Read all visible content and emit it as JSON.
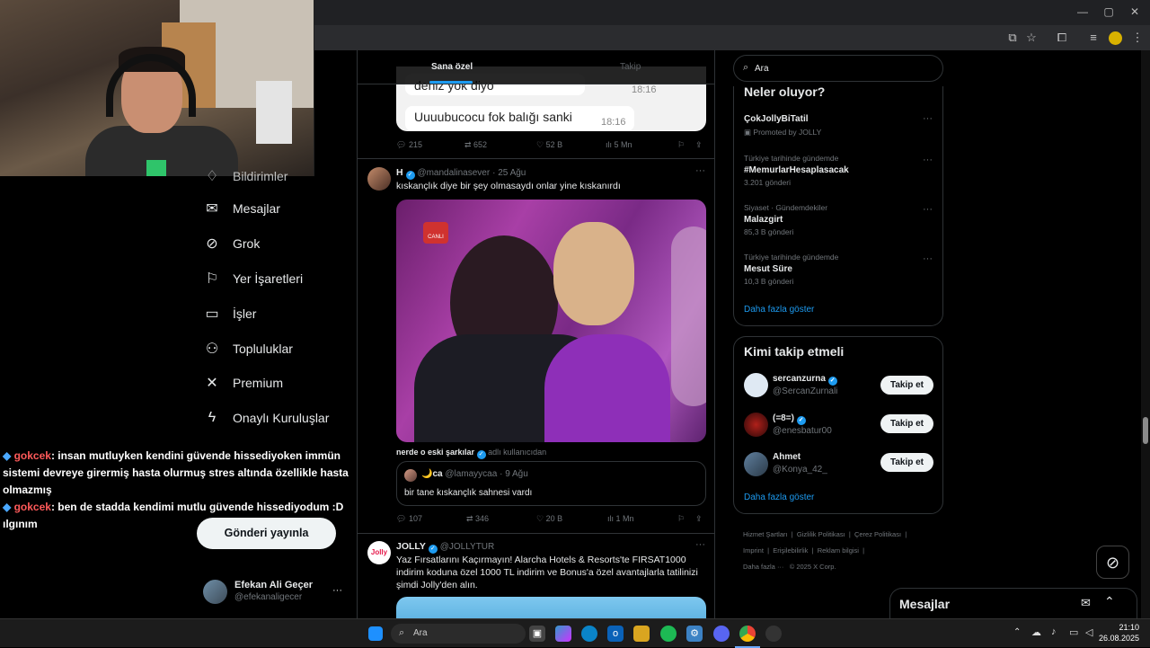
{
  "browser": {
    "minimize": "—",
    "maximize": "▢",
    "close": "✕"
  },
  "nav": {
    "partial_top": "Bildirimler",
    "items": [
      {
        "label": "Mesajlar",
        "icon": "envelope-icon"
      },
      {
        "label": "Grok",
        "icon": "grok-icon"
      },
      {
        "label": "Yer İşaretleri",
        "icon": "bookmark-icon"
      },
      {
        "label": "İşler",
        "icon": "briefcase-icon"
      },
      {
        "label": "Topluluklar",
        "icon": "people-icon"
      },
      {
        "label": "Premium",
        "icon": "x-logo-icon"
      },
      {
        "label": "Onaylı Kuruluşlar",
        "icon": "lightning-icon"
      }
    ],
    "post_button": "Gönderi yayınla",
    "profile": {
      "name": "Efekan Ali Geçer",
      "handle": "@efekanaligecer",
      "more": "···"
    }
  },
  "chat": [
    {
      "user": "gokcek",
      "text": ": insan mutluyken kendini güvende hissediyoken immün sistemi devreye girermiş hasta olurmuş stres altında özellikle hasta olmazmış"
    },
    {
      "user": "gokcek",
      "text": ": ben de stadda kendimi mutlu güvende hissediyodum :D ılgınım"
    }
  ],
  "feed": {
    "tabs": {
      "active": "Sana özel",
      "other": "Takip"
    },
    "prev_media": {
      "line1": "deniz yok diyo",
      "time1": "18:16",
      "line2": "Uuuubucocu fok balığı sanki",
      "time2": "18:16"
    },
    "prev_actions": {
      "replies": "215",
      "reposts": "652",
      "likes": "52 B",
      "views": "5 Mn"
    },
    "tweet1": {
      "name": "H",
      "handle": "@mandalinasever",
      "date": "· 25 Ağu",
      "text": "kıskançlık diye bir şey olmasaydı onlar yine kıskanırdı",
      "media_badge": "CANLI",
      "quote_header_name": "nerde o eski şarkılar",
      "quote_header_handle": "adlı kullanıcıdan",
      "quote": {
        "name": "🌙ca",
        "handle": "@lamayycaa",
        "date": "· 9 Ağu",
        "text": "bir tane kıskançlık sahnesi vardı"
      },
      "actions": {
        "replies": "107",
        "reposts": "346",
        "likes": "20 B",
        "views": "1 Mn"
      }
    },
    "tweet2": {
      "name": "JOLLY",
      "handle": "@JOLLYTUR",
      "avatar_text": "Jolly",
      "text": "Yaz Fırsatlarını Kaçırmayın! Alarcha Hotels & Resorts'te FIRSAT1000 indirim koduna özel 1000 TL indirim ve Bonus'a özel avantajlarla tatilinizi şimdi Jolly'den alın."
    }
  },
  "right": {
    "search_placeholder": "Ara",
    "trends_title": "Neler oluyor?",
    "trends": [
      {
        "context": "",
        "name": "ÇokJollyBiTatil",
        "meta": "Promoted by JOLLY"
      },
      {
        "context": "Türkiye tarihinde gündemde",
        "name": "#MemurlarHesaplasacak",
        "meta": "3.201 gönderi"
      },
      {
        "context": "Siyaset · Gündemdekiler",
        "name": "Malazgirt",
        "meta": "85,3 B gönderi"
      },
      {
        "context": "Türkiye tarihinde gündemde",
        "name": "Mesut Süre",
        "meta": "10,3 B gönderi"
      }
    ],
    "trends_more": "Daha fazla göster",
    "who_title": "Kimi takip etmeli",
    "who": [
      {
        "name": "sercanzurna",
        "handle": "@SercanZurnali",
        "button": "Takip et"
      },
      {
        "name": "(=8=)",
        "handle": "@enesbatur00",
        "button": "Takip et"
      },
      {
        "name": "Ahmet",
        "handle": "@Konya_42_",
        "button": "Takip et"
      }
    ],
    "who_more": "Daha fazla göster",
    "footer": [
      "Hizmet Şartları",
      "Gizlilik Politikası",
      "Çerez Politikası",
      "Imprint",
      "Erişilebilirlik",
      "Reklam bilgisi",
      "Daha fazla ···",
      "© 2025 X Corp."
    ],
    "messages": "Mesajlar"
  },
  "taskbar": {
    "search": "Ara",
    "time": "21:10",
    "date": "26.08.2025"
  }
}
